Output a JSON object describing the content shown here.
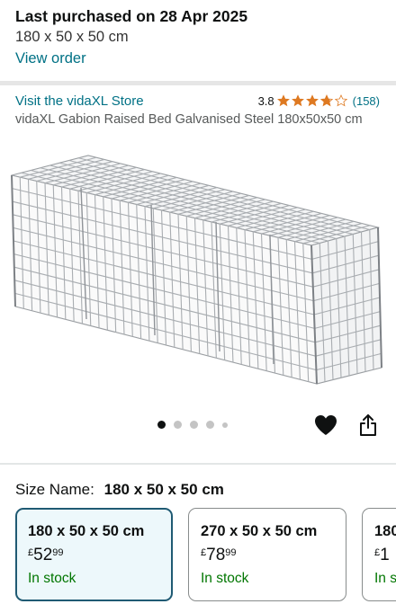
{
  "purchase": {
    "title": "Last purchased on 28 Apr 2025",
    "variant": "180 x 50 x 50 cm",
    "view_order": "View order"
  },
  "store": {
    "link": "Visit the vidaXL Store",
    "rating": "3.8",
    "rating_stars": 3.8,
    "review_count": "(158)",
    "star_color": "#de7921"
  },
  "product": {
    "title": "vidaXL Gabion Raised Bed Galvanised Steel 180x50x50 cm",
    "image": "gabion-raised-bed-photo"
  },
  "carousel": {
    "total_dots": 5,
    "active_index": 0
  },
  "actions": {
    "wishlist_icon": "heart-icon",
    "share_icon": "share-icon"
  },
  "size": {
    "label": "Size Name:",
    "selected": "180 x 50 x 50 cm",
    "options": [
      {
        "name": "180 x 50 x 50 cm",
        "currency": "£",
        "whole": "52",
        "fraction": "99",
        "stock": "In stock",
        "selected": true
      },
      {
        "name": "270 x 50 x 50 cm",
        "currency": "£",
        "whole": "78",
        "fraction": "99",
        "stock": "In stock",
        "selected": false
      },
      {
        "name": "180",
        "currency": "£",
        "whole": "1",
        "fraction": "",
        "stock": "In s",
        "selected": false
      }
    ]
  },
  "colors": {
    "link": "#007185",
    "stock": "#007600",
    "selected_border": "#1f5a73",
    "selected_bg": "#edf8fb"
  }
}
